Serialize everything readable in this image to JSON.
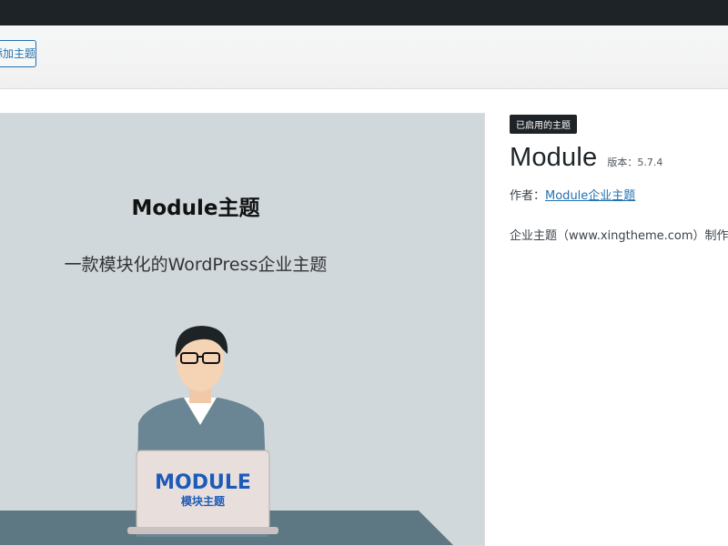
{
  "header": {
    "add_theme_label": "添加主题"
  },
  "screenshot": {
    "title": "Module主题",
    "subtitle": "一款模块化的WordPress企业主题",
    "laptop_logo": "MODULE",
    "laptop_logo_sub": "模块主题"
  },
  "theme": {
    "active_badge": "已启用的主题",
    "name": "Module",
    "version_label": "版本：",
    "version": "5.7.4",
    "author_label": "作者：",
    "author_name": "Module企业主题",
    "description": "企业主题（www.xingtheme.com）制作"
  },
  "colors": {
    "admin_bar": "#1d2327",
    "link": "#2271b1",
    "screenshot_bg": "#d0d8dc",
    "logo_blue": "#1e5bb8",
    "logo_red": "#e5343a"
  }
}
